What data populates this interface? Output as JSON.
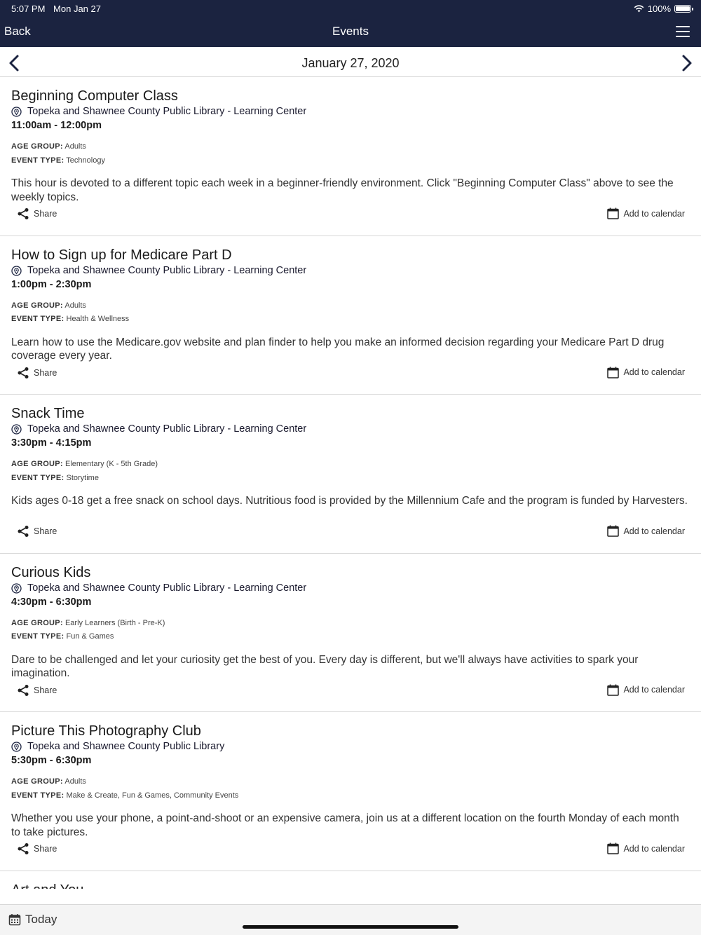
{
  "status_bar": {
    "time": "5:07 PM",
    "date": "Mon Jan 27",
    "battery": "100%"
  },
  "nav": {
    "back_label": "Back",
    "title": "Events"
  },
  "date_bar": {
    "date": "January 27, 2020"
  },
  "labels": {
    "age_group": "AGE GROUP:",
    "event_type": "EVENT TYPE:",
    "share": "Share",
    "add_to_calendar": "Add to calendar"
  },
  "events": [
    {
      "title": "Beginning Computer Class",
      "location": "Topeka and Shawnee County Public Library - Learning Center",
      "time": "11:00am - 12:00pm",
      "age_group": "Adults",
      "event_type": "Technology",
      "description": "This hour is devoted to a different topic each week in a beginner-friendly environment. Click \"Beginning Computer Class\" above to see the weekly topics."
    },
    {
      "title": "How to Sign up for Medicare Part D",
      "location": "Topeka and Shawnee County Public Library - Learning Center",
      "time": "1:00pm - 2:30pm",
      "age_group": "Adults",
      "event_type": "Health & Wellness",
      "description": "Learn how to use the Medicare.gov website and plan finder to help you make an informed decision regarding your Medicare Part D drug coverage every year."
    },
    {
      "title": "Snack Time",
      "location": "Topeka and Shawnee County Public Library - Learning Center",
      "time": "3:30pm - 4:15pm",
      "age_group": "Elementary (K - 5th Grade)",
      "event_type": "Storytime",
      "description": "Kids ages 0-18 get a free snack on school days. Nutritious food is provided by the Millennium Cafe and the program is funded by Harvesters."
    },
    {
      "title": "Curious Kids",
      "location": "Topeka and Shawnee County Public Library - Learning Center",
      "time": "4:30pm - 6:30pm",
      "age_group": "Early Learners (Birth - Pre-K)",
      "event_type": "Fun & Games",
      "description": "Dare to be challenged and let your curiosity get the best of you. Every day is different, but we'll always have activities to spark your imagination."
    },
    {
      "title": "Picture This Photography Club",
      "location": "Topeka and Shawnee County Public Library",
      "time": "5:30pm - 6:30pm",
      "age_group": "Adults",
      "event_type": "Make & Create, Fun & Games, Community Events",
      "description": "Whether you use your phone, a point-and-shoot or an expensive camera, join us at a different location on the fourth Monday of each month to take pictures."
    }
  ],
  "partial_event": {
    "title": "Art and You"
  },
  "bottom_bar": {
    "today_label": "Today"
  }
}
